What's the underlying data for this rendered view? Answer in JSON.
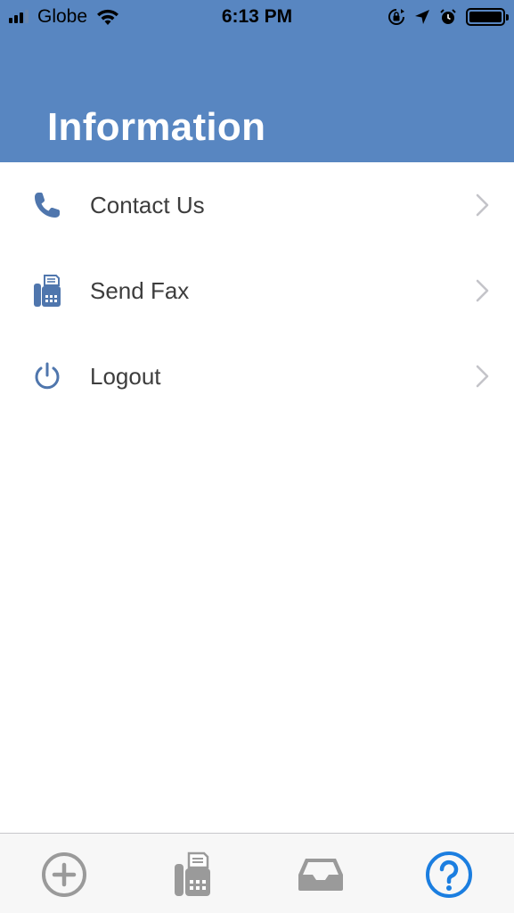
{
  "status_bar": {
    "carrier": "Globe",
    "time": "6:13 PM",
    "icons": [
      "signal-bars-icon",
      "wifi-icon",
      "orientation-lock-icon",
      "location-arrow-icon",
      "alarm-icon",
      "battery-icon"
    ]
  },
  "header": {
    "title": "Information",
    "background_color": "#5886c1"
  },
  "menu": {
    "items": [
      {
        "label": "Contact Us",
        "icon": "phone-icon"
      },
      {
        "label": "Send Fax",
        "icon": "fax-icon"
      },
      {
        "label": "Logout",
        "icon": "power-icon"
      }
    ],
    "icon_color": "#4f76ad",
    "chevron_icon": "chevron-right-icon"
  },
  "tab_bar": {
    "tabs": [
      {
        "icon": "add-circle-icon",
        "active": false
      },
      {
        "icon": "fax-icon",
        "active": false
      },
      {
        "icon": "inbox-tray-icon",
        "active": false
      },
      {
        "icon": "help-circle-icon",
        "active": true
      }
    ],
    "active_color": "#1b7ee0",
    "inactive_color": "#9a9a9a"
  }
}
